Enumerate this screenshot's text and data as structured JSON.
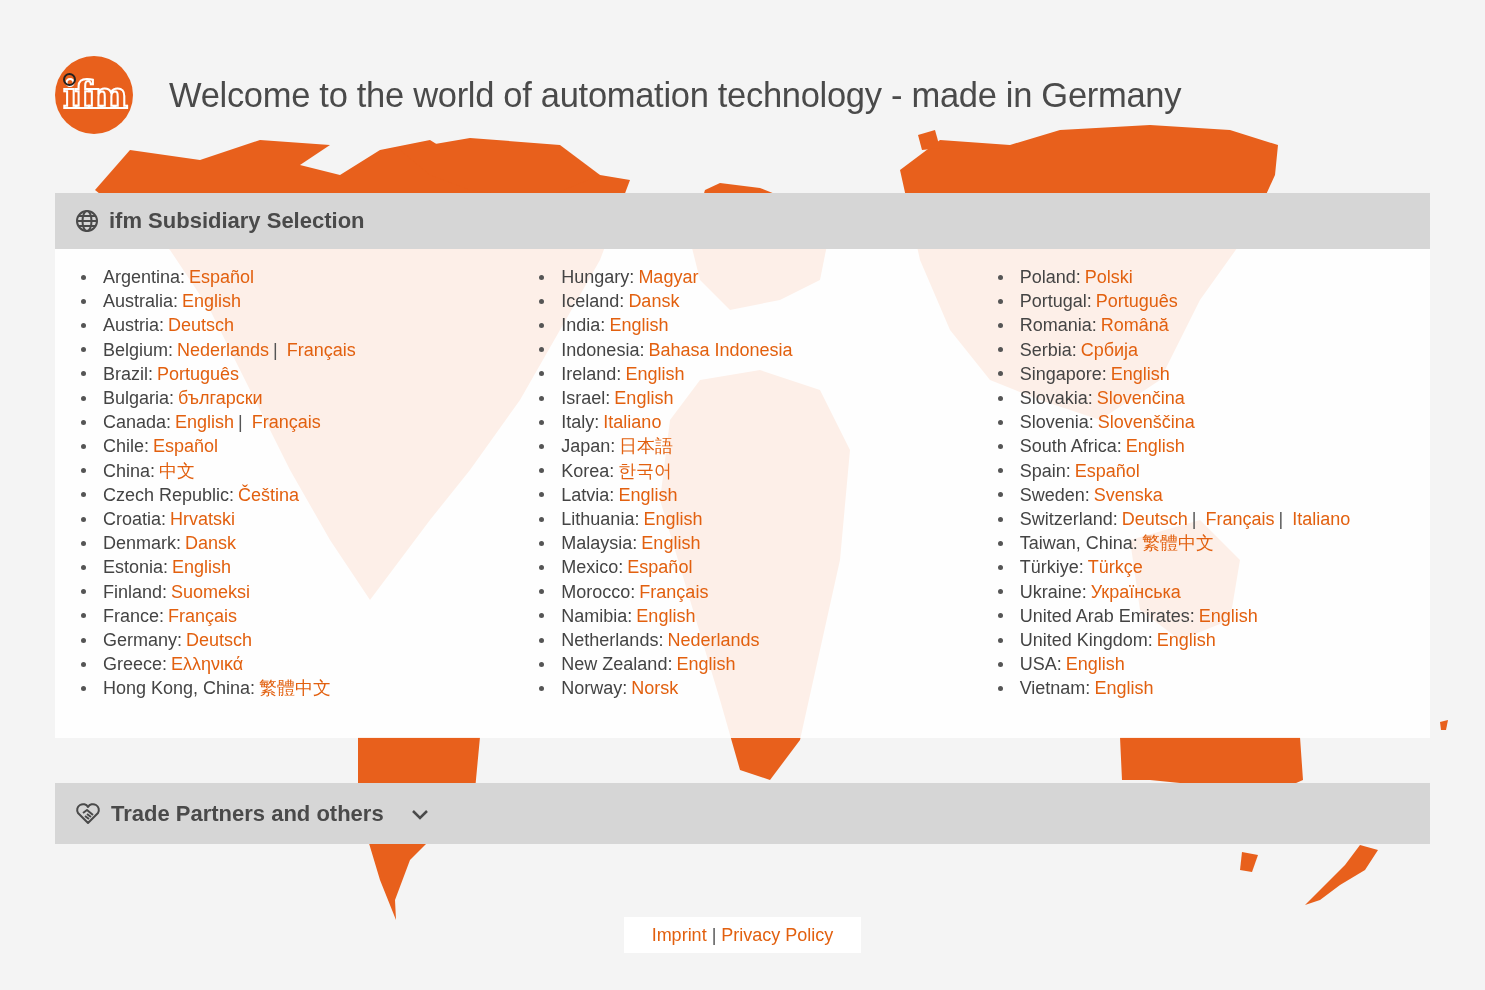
{
  "logo": {
    "text": "ifm"
  },
  "title": "Welcome to the world of automation technology - made in Germany",
  "subsidiaries": {
    "title": "ifm Subsidiary Selection",
    "columns": [
      [
        {
          "country": "Argentina:",
          "links": [
            "Español"
          ]
        },
        {
          "country": "Australia:",
          "links": [
            "English"
          ]
        },
        {
          "country": "Austria:",
          "links": [
            "Deutsch"
          ]
        },
        {
          "country": "Belgium:",
          "links": [
            "Nederlands",
            "Français"
          ],
          "separators": [
            "|"
          ]
        },
        {
          "country": "Brazil:",
          "links": [
            "Português"
          ]
        },
        {
          "country": "Bulgaria:",
          "links": [
            "български"
          ]
        },
        {
          "country": "Canada:",
          "links": [
            "English",
            "Français"
          ],
          "separators": [
            "|"
          ]
        },
        {
          "country": "Chile:",
          "links": [
            "Español"
          ]
        },
        {
          "country": "China:",
          "links": [
            "中文"
          ]
        },
        {
          "country": "Czech Republic:",
          "links": [
            "Čeština"
          ]
        },
        {
          "country": "Croatia:",
          "links": [
            "Hrvatski"
          ]
        },
        {
          "country": "Denmark:",
          "links": [
            "Dansk"
          ]
        },
        {
          "country": "Estonia:",
          "links": [
            "English"
          ]
        },
        {
          "country": "Finland:",
          "links": [
            "Suomeksi"
          ]
        },
        {
          "country": "France:",
          "links": [
            "Français"
          ]
        },
        {
          "country": "Germany:",
          "links": [
            "Deutsch"
          ]
        },
        {
          "country": "Greece:",
          "links": [
            "Ελληνικά"
          ]
        },
        {
          "country": "Hong Kong, China:",
          "links": [
            "繁體中文"
          ]
        }
      ],
      [
        {
          "country": "Hungary:",
          "links": [
            "Magyar"
          ]
        },
        {
          "country": "Iceland:",
          "links": [
            "Dansk"
          ]
        },
        {
          "country": "India:",
          "links": [
            "English"
          ]
        },
        {
          "country": "Indonesia:",
          "links": [
            "Bahasa Indonesia"
          ]
        },
        {
          "country": "Ireland:",
          "links": [
            "English"
          ]
        },
        {
          "country": "Israel:",
          "links": [
            "English"
          ]
        },
        {
          "country": "Italy:",
          "links": [
            "Italiano"
          ]
        },
        {
          "country": "Japan:",
          "links": [
            "日本語"
          ]
        },
        {
          "country": "Korea:",
          "links": [
            "한국어"
          ]
        },
        {
          "country": "Latvia:",
          "links": [
            "English"
          ]
        },
        {
          "country": "Lithuania:",
          "links": [
            "English"
          ]
        },
        {
          "country": "Malaysia:",
          "links": [
            "English"
          ]
        },
        {
          "country": "Mexico:",
          "links": [
            "Español"
          ]
        },
        {
          "country": "Morocco:",
          "links": [
            "Français"
          ]
        },
        {
          "country": "Namibia:",
          "links": [
            "English"
          ]
        },
        {
          "country": "Netherlands:",
          "links": [
            "Nederlands"
          ]
        },
        {
          "country": "New Zealand:",
          "links": [
            "English"
          ]
        },
        {
          "country": "Norway:",
          "links": [
            "Norsk"
          ]
        }
      ],
      [
        {
          "country": "Poland:",
          "links": [
            "Polski"
          ]
        },
        {
          "country": "Portugal:",
          "links": [
            "Português"
          ]
        },
        {
          "country": "Romania:",
          "links": [
            "Română"
          ]
        },
        {
          "country": "Serbia:",
          "links": [
            "Србија"
          ]
        },
        {
          "country": "Singapore:",
          "links": [
            "English"
          ]
        },
        {
          "country": "Slovakia:",
          "links": [
            "Slovenčina"
          ]
        },
        {
          "country": "Slovenia:",
          "links": [
            "Slovenščina"
          ]
        },
        {
          "country": "South Africa:",
          "links": [
            "English"
          ]
        },
        {
          "country": "Spain:",
          "links": [
            "Español"
          ]
        },
        {
          "country": "Sweden:",
          "links": [
            "Svenska"
          ]
        },
        {
          "country": "Switzerland:",
          "links": [
            "Deutsch",
            "Français",
            "Italiano"
          ],
          "separators": [
            "|",
            "|"
          ]
        },
        {
          "country": "Taiwan, China:",
          "links": [
            "繁體中文"
          ]
        },
        {
          "country": "Türkiye:",
          "links": [
            "Türkçe"
          ]
        },
        {
          "country": "Ukraine:",
          "links": [
            "Українська"
          ]
        },
        {
          "country": "United Arab Emirates:",
          "links": [
            "English"
          ]
        },
        {
          "country": "United Kingdom:",
          "links": [
            "English"
          ]
        },
        {
          "country": "USA:",
          "links": [
            "English"
          ]
        },
        {
          "country": "Vietnam:",
          "links": [
            "English"
          ]
        }
      ]
    ]
  },
  "partners": {
    "title": "Trade Partners and others",
    "expanded": false
  },
  "footer": {
    "links": [
      "Imprint",
      "Privacy Policy"
    ],
    "separators": [
      "|"
    ]
  }
}
